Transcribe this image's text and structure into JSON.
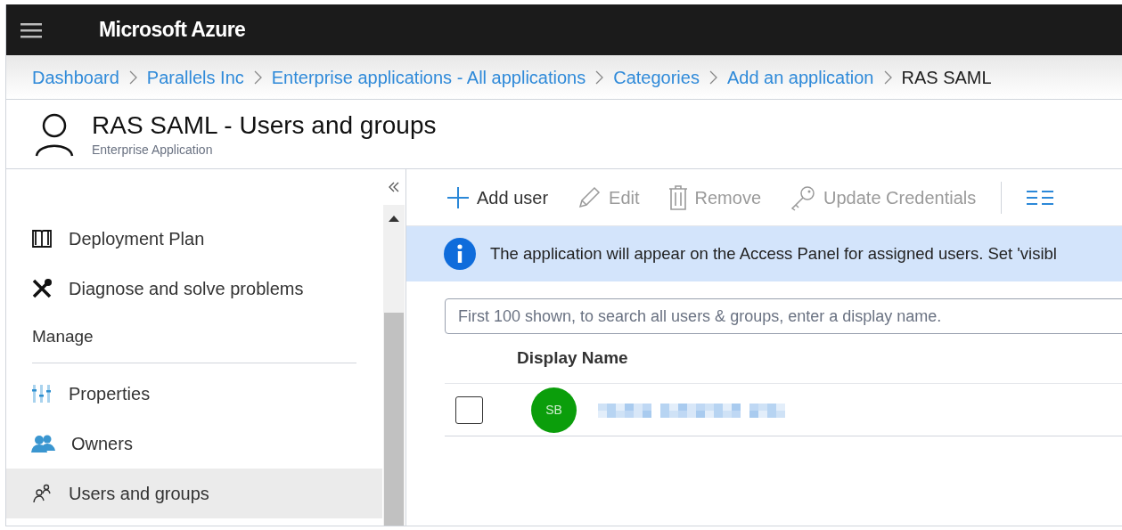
{
  "top_bar": {
    "title": "Microsoft Azure"
  },
  "breadcrumb": [
    {
      "label": "Dashboard",
      "link": true
    },
    {
      "label": "Parallels Inc",
      "link": true
    },
    {
      "label": "Enterprise applications - All applications",
      "link": true
    },
    {
      "label": "Categories",
      "link": true
    },
    {
      "label": "Add an application",
      "link": true
    },
    {
      "label": "RAS SAML",
      "link": false
    }
  ],
  "header": {
    "title": "RAS SAML - Users and groups",
    "subtitle": "Enterprise Application"
  },
  "sidebar": {
    "items": [
      {
        "kind": "item",
        "label": "Deployment Plan",
        "selected": false
      },
      {
        "kind": "item",
        "label": "Diagnose and solve problems",
        "selected": false
      },
      {
        "kind": "heading",
        "label": "Manage"
      },
      {
        "kind": "item",
        "label": "Properties",
        "selected": false
      },
      {
        "kind": "item",
        "label": "Owners",
        "selected": false
      },
      {
        "kind": "item",
        "label": "Users and groups",
        "selected": true
      }
    ]
  },
  "toolbar": [
    {
      "label": "Add user",
      "disabled": false
    },
    {
      "label": "Edit",
      "disabled": true
    },
    {
      "label": "Remove",
      "disabled": true
    },
    {
      "label": "Update Credentials",
      "disabled": true
    }
  ],
  "info_banner": "The application will appear on the Access Panel for assigned users. Set 'visibl",
  "search": {
    "placeholder": "First 100 shown, to search all users & groups, enter a display name."
  },
  "table": {
    "columns": [
      "Display Name"
    ],
    "rows": [
      {
        "checked": false,
        "initials": "SB",
        "color": "#0b9e0b"
      }
    ]
  }
}
